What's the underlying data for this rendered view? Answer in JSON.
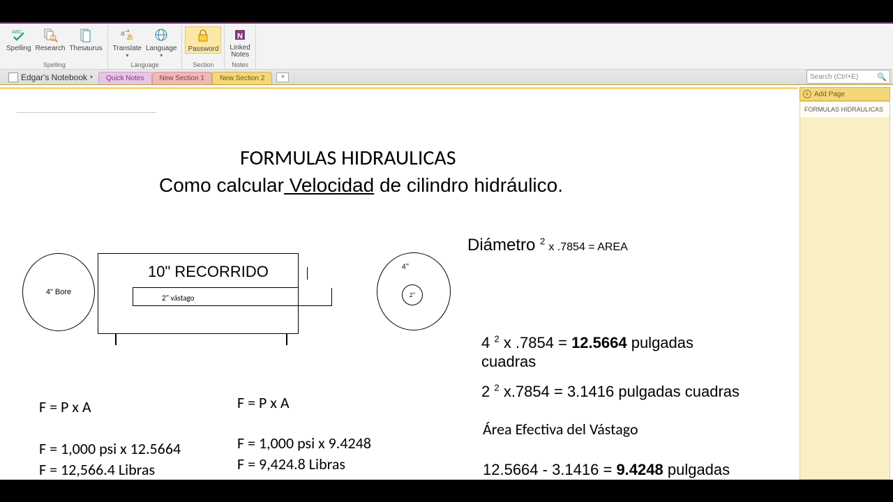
{
  "ribbon": {
    "groups": [
      {
        "label": "Spelling",
        "items": [
          {
            "name": "spelling-button",
            "label": "Spelling"
          },
          {
            "name": "research-button",
            "label": "Research"
          },
          {
            "name": "thesaurus-button",
            "label": "Thesaurus"
          }
        ]
      },
      {
        "label": "Language",
        "items": [
          {
            "name": "translate-button",
            "label": "Translate"
          },
          {
            "name": "language-button",
            "label": "Language"
          }
        ]
      },
      {
        "label": "Section",
        "items": [
          {
            "name": "password-button",
            "label": "Password",
            "active": true
          }
        ]
      },
      {
        "label": "Notes",
        "items": [
          {
            "name": "linked-notes-button",
            "label": "Linked\nNotes"
          }
        ]
      }
    ]
  },
  "notebook": {
    "name": "Edgar's Notebook"
  },
  "tabs": [
    {
      "label": "Quick Notes",
      "cls": "tab-pink"
    },
    {
      "label": "New Section 1",
      "cls": "tab-red"
    },
    {
      "label": "New Section 2",
      "cls": "tab-gold"
    }
  ],
  "search": {
    "placeholder": "Search (Ctrl+E)"
  },
  "addPage": {
    "label": "Add Page"
  },
  "sidePages": [
    "FORMULAS HIDRAULICAS"
  ],
  "content": {
    "title": "FORMULAS HIDRAULICAS",
    "subtitle_pre": "Como calcular",
    "subtitle_u": " Velocidad",
    "subtitle_post": " de cilindro hidráulico.",
    "bore_label": "4\" Bore",
    "recorrido": "10\" RECORRIDO",
    "vastago": "2\" vástago",
    "ring_outer": "4\"",
    "ring_inner": "2\"",
    "formula_area_pre": "Diámetro ",
    "formula_area_sup": "2",
    "formula_area_post": " x .7854 = AREA",
    "calc1_pre": "4 ",
    "calc1_sup": "2",
    "calc1_mid": " x .7854 = ",
    "calc1_bold": "12.5664",
    "calc1_post": " pulgadas cuadras",
    "calc2_pre": "2 ",
    "calc2_sup": "2",
    "calc2_post": " x.7854 = 3.1416 pulgadas cuadras",
    "area_ef": "Área Efectiva del Vástago",
    "calc3_pre": "12.5664 - 3.1416 = ",
    "calc3_bold": "9.4248",
    "calc3_post": " pulgadas",
    "left": {
      "f1": "F = P x A",
      "f2": "F = 1,000 psi x 12.5664",
      "f3": "F = 12,566.4 Libras"
    },
    "mid": {
      "f1": "F = P x A",
      "f2": "F = 1,000 psi x 9.4248",
      "f3": "F = 9,424.8 Libras"
    }
  }
}
